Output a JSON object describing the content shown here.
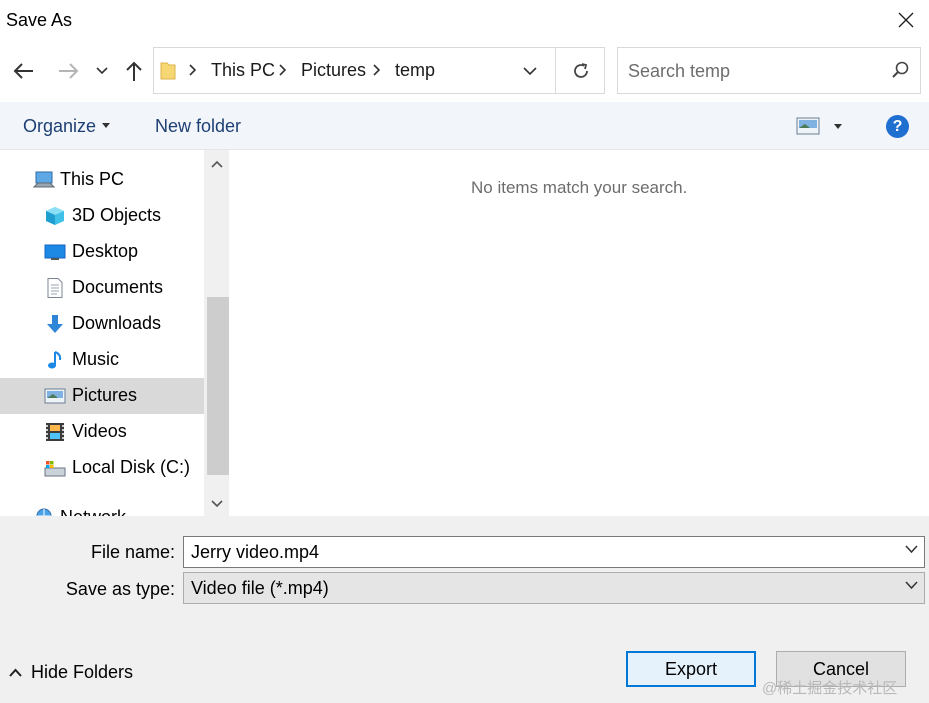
{
  "window": {
    "title": "Save As"
  },
  "navigation": {
    "breadcrumbs": [
      "This PC",
      "Pictures",
      "temp"
    ],
    "search_placeholder": "Search temp"
  },
  "toolbar": {
    "organize_label": "Organize",
    "new_folder_label": "New folder",
    "help_label": "?"
  },
  "sidebar": {
    "items": [
      {
        "label": "This PC",
        "icon": "computer-icon",
        "selected": false
      },
      {
        "label": "3D Objects",
        "icon": "cube-icon",
        "selected": false
      },
      {
        "label": "Desktop",
        "icon": "desktop-icon",
        "selected": false
      },
      {
        "label": "Documents",
        "icon": "document-icon",
        "selected": false
      },
      {
        "label": "Downloads",
        "icon": "download-arrow-icon",
        "selected": false
      },
      {
        "label": "Music",
        "icon": "music-note-icon",
        "selected": false
      },
      {
        "label": "Pictures",
        "icon": "picture-icon",
        "selected": true
      },
      {
        "label": "Videos",
        "icon": "film-icon",
        "selected": false
      },
      {
        "label": "Local Disk (C:)",
        "icon": "drive-icon",
        "selected": false
      },
      {
        "label": "Network",
        "icon": "network-icon",
        "selected": false
      }
    ]
  },
  "content": {
    "empty_message": "No items match your search."
  },
  "form": {
    "file_name_label": "File name:",
    "file_name_value": "Jerry video.mp4",
    "save_type_label": "Save as type:",
    "save_type_value": "Video file (*.mp4)"
  },
  "footer": {
    "hide_folders_label": "Hide Folders",
    "export_label": "Export",
    "cancel_label": "Cancel",
    "watermark": "@稀土掘金技术社区"
  },
  "colors": {
    "accent": "#0078d7",
    "toolbar_text": "#1e3f73",
    "selected_row": "#d9d9d9",
    "bottom_panel": "#f0f0f0"
  }
}
